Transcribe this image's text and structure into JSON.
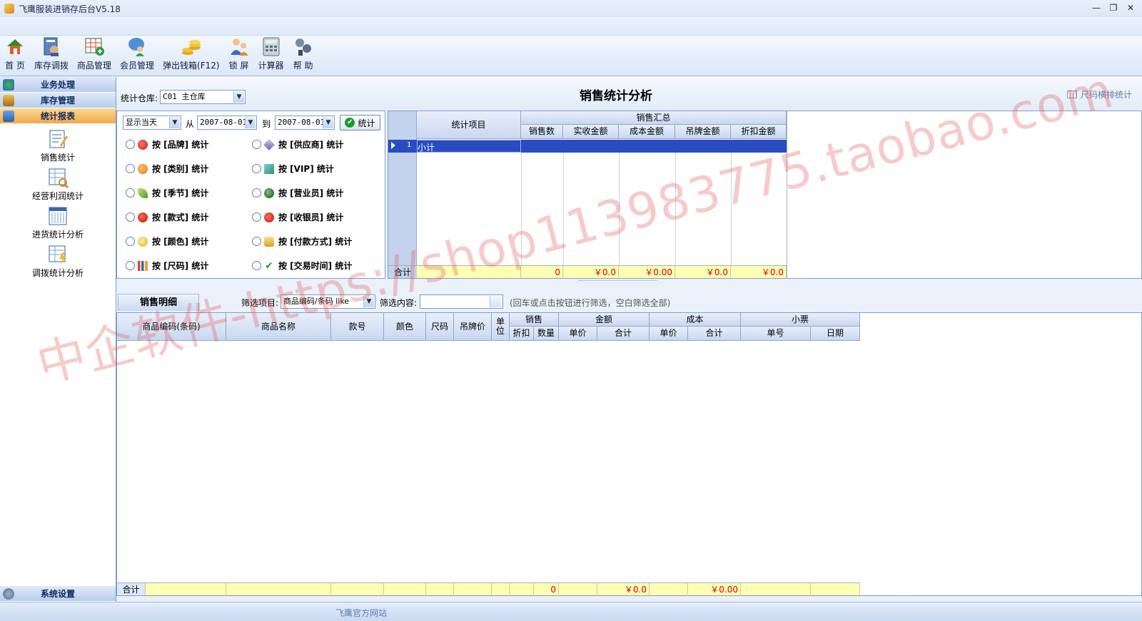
{
  "window": {
    "title": "飞鹰服装进销存后台V5.18",
    "controls": [
      "—",
      "❐",
      "✕"
    ]
  },
  "toolbar": {
    "items": [
      {
        "label": "首 页",
        "icon": "home-icon"
      },
      {
        "label": "库存调拨",
        "icon": "inventory-transfer-icon"
      },
      {
        "label": "商品管理",
        "icon": "product-management-icon"
      },
      {
        "label": "会员管理",
        "icon": "member-management-icon"
      },
      {
        "label": "弹出钱箱(F12)",
        "icon": "cash-drawer-icon"
      },
      {
        "label": "锁 屏",
        "icon": "lock-screen-icon"
      },
      {
        "label": "计算器",
        "icon": "calculator-icon"
      },
      {
        "label": "帮 助",
        "icon": "help-icon"
      }
    ]
  },
  "sidebar": {
    "sections": [
      {
        "label": "业务处理",
        "icon": "business-icon",
        "active": false
      },
      {
        "label": "库存管理",
        "icon": "stock-icon",
        "active": false
      },
      {
        "label": "统计报表",
        "icon": "report-icon",
        "active": true
      }
    ],
    "items": [
      {
        "label": "销售统计",
        "icon": "sales-stat-icon"
      },
      {
        "label": "经营利润统计",
        "icon": "profit-stat-icon"
      },
      {
        "label": "进货统计分析",
        "icon": "purchase-stat-icon"
      },
      {
        "label": "调拨统计分析",
        "icon": "transfer-stat-icon"
      }
    ],
    "bottom": {
      "label": "系统设置",
      "icon": "system-settings-icon"
    }
  },
  "header": {
    "warehouse_label": "统计仓库:",
    "warehouse_value": "C01 主仓库",
    "page_title": "销售统计分析",
    "size_link": "尺码横排统计"
  },
  "filter": {
    "period": "显示当天",
    "from_label": "从",
    "from_date": "2007-08-01",
    "to_label": "到",
    "to_date": "2007-08-01",
    "stat_button": "统计",
    "options": [
      {
        "label": "按 [品牌] 统计",
        "icon": "apple-red-icon"
      },
      {
        "label": "按 [供应商] 统计",
        "icon": "diamond-icon"
      },
      {
        "label": "按 [类别] 统计",
        "icon": "orange-icon"
      },
      {
        "label": "按 [VIP] 统计",
        "icon": "box-icon"
      },
      {
        "label": "按 [季节] 统计",
        "icon": "leaf-icon"
      },
      {
        "label": "按 [营业员] 统计",
        "icon": "globe-icon"
      },
      {
        "label": "按 [款式] 统计",
        "icon": "heart-icon"
      },
      {
        "label": "按 [收银员] 统计",
        "icon": "tomato-icon"
      },
      {
        "label": "按 [颜色] 统计",
        "icon": "smile-icon"
      },
      {
        "label": "按 [付款方式] 统计",
        "icon": "coins-icon"
      },
      {
        "label": "按 [尺码] 统计",
        "icon": "bars-icon"
      },
      {
        "label": "按 [交易时间] 统计",
        "icon": "check-icon"
      }
    ]
  },
  "summary": {
    "col_item": "统计项目",
    "group_label": "销售汇总",
    "columns": [
      "销售数",
      "实收金额",
      "成本金额",
      "吊牌金额",
      "折扣金额"
    ],
    "row": {
      "num": "1",
      "label": "小计"
    },
    "total_label": "合计",
    "totals": [
      "0",
      "￥0.0",
      "￥0.00",
      "￥0.0",
      "￥0.0"
    ]
  },
  "detail": {
    "tab_label": "销售明细",
    "filter_item_label": "筛选项目:",
    "filter_item_value": "商品编码/条码 like",
    "filter_content_label": "筛选内容:",
    "filter_content_value": "",
    "hint": "(回车或点击按钮进行筛选，空白筛选全部)",
    "headers": {
      "code": "商品编码(条码)",
      "name": "商品名称",
      "style": "款号",
      "color": "颜色",
      "size": "尺码",
      "tag_price": "吊牌价",
      "unit": "单位",
      "sales": "销售",
      "discount": "折扣",
      "qty": "数量",
      "amount": "金额",
      "amount_price": "单价",
      "amount_total": "合计",
      "cost": "成本",
      "cost_price": "单价",
      "cost_total": "合计",
      "receipt": "小票",
      "receipt_no": "单号",
      "receipt_date": "日期"
    },
    "total_label": "合计",
    "totals": {
      "qty": "0",
      "amount_total": "￥0.0",
      "cost_total": "￥0.00"
    }
  },
  "statusbar": {
    "link": "飞鹰官方网站"
  },
  "watermark": "中企软件-https://shop113983775.taobao.com"
}
